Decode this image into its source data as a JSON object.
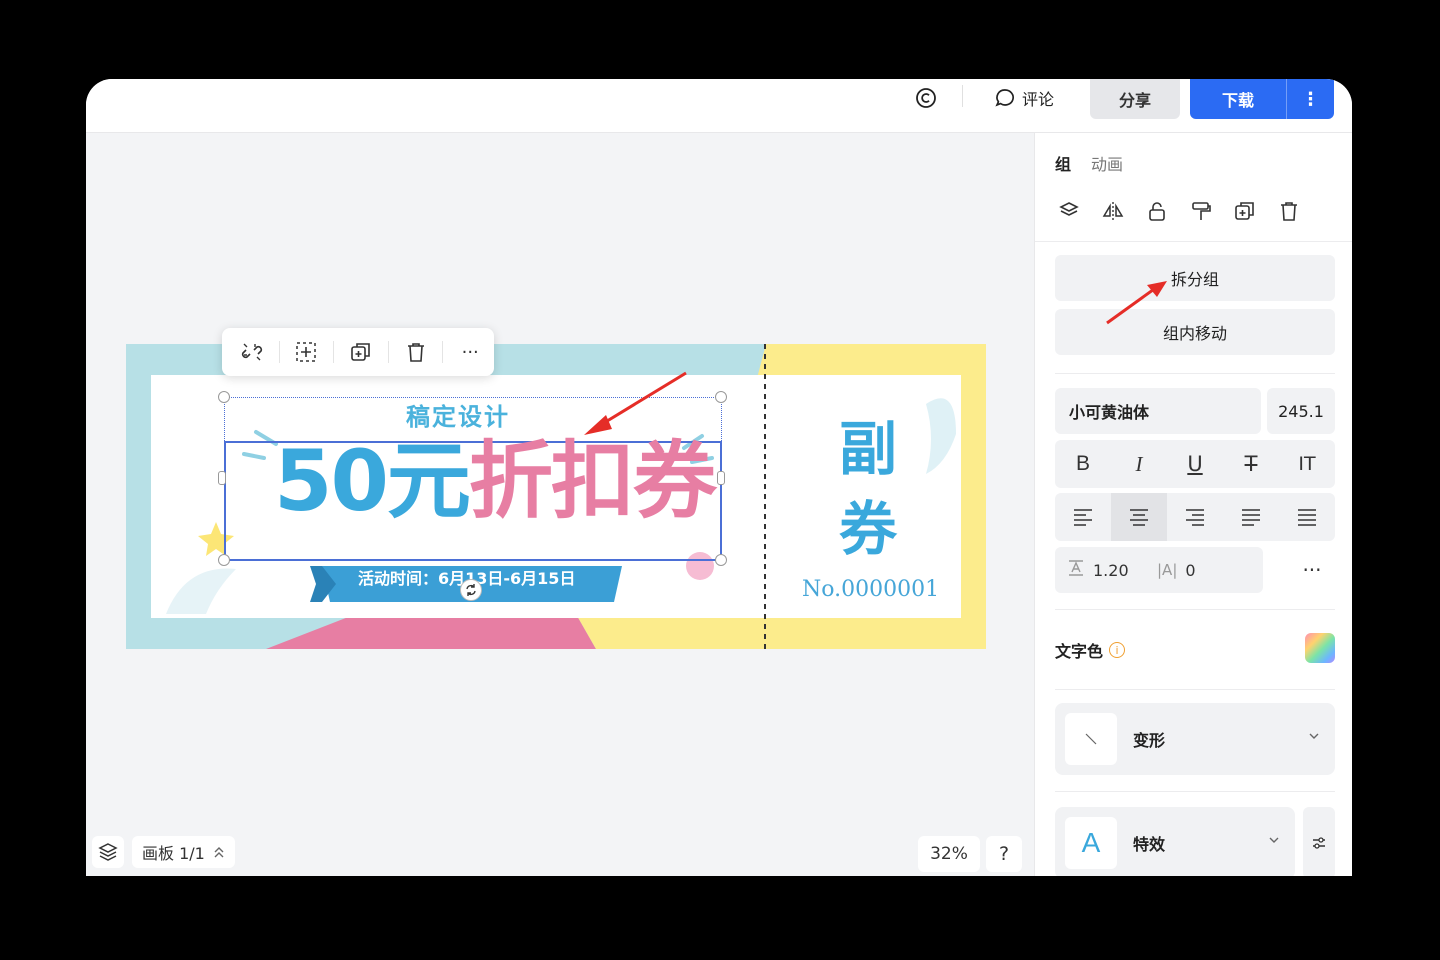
{
  "topbar": {
    "comment_label": "评论",
    "share_label": "分享",
    "download_label": "下载",
    "more_label": "⋮"
  },
  "canvas": {
    "design_title": "稿定设计",
    "headline_blue": "50元",
    "headline_pink": "折扣券",
    "activity_time": "活动时间：6月13日-6月15日",
    "stub_text": "副券",
    "serial_number": "No.0000001",
    "board_label": "画板 1/1",
    "zoom": "32%",
    "help": "?"
  },
  "panel": {
    "tabs": [
      "组",
      "动画"
    ],
    "ungroup_button": "拆分组",
    "move_in_group_button": "组内移动",
    "font_name": "小可黄油体",
    "font_size": "245.1",
    "format_buttons": [
      "B",
      "I",
      "U",
      "T",
      "IT"
    ],
    "line_height": "1.20",
    "letter_spacing": "0",
    "more": "···",
    "text_color_label": "文字色",
    "transform_label": "变形",
    "effects_label": "特效",
    "effects_thumb": "A"
  },
  "colors": {
    "primary": "#2b6bf3",
    "coupon_blue": "#3aa8dc",
    "coupon_pink": "#e77ea3",
    "coupon_yellow": "#fcec8c",
    "coupon_teal": "#b7e0e6"
  }
}
